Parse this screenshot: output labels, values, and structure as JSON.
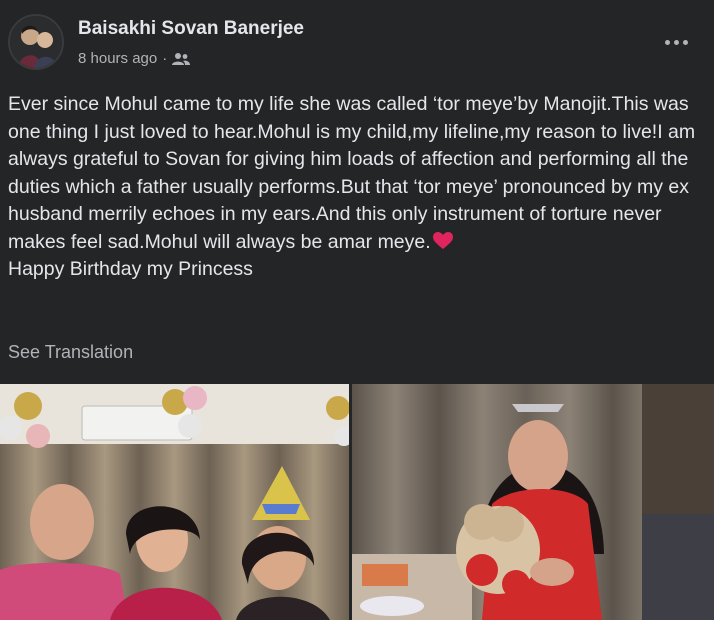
{
  "post": {
    "author": "Baisakhi Sovan Banerjee",
    "time": "8 hours ago",
    "separator": "·",
    "audience_icon": "friends-icon",
    "more_icon": "more-options-icon",
    "paragraphs": [
      "Ever since Mohul came to my life she was called ‘tor meye’by Manojit.This was one thing I just loved to hear.Mohul is my child,my lifeline,my reason to live!I am always grateful to Sovan for giving him loads of affection and performing all the duties which a father usually performs.But that ‘tor meye’ pronounced by my ex husband merrily echoes in my ears.And this only instrument of torture never makes feel sad.Mohul will always be amar meye.",
      "Happy Birthday my Princess"
    ],
    "heart_icon": "red-heart-emoji",
    "see_translation": "See Translation"
  },
  "colors": {
    "background": "#242526",
    "primary_text": "#e4e6eb",
    "secondary_text": "#b0b3b8",
    "heart": "#e0245e"
  }
}
